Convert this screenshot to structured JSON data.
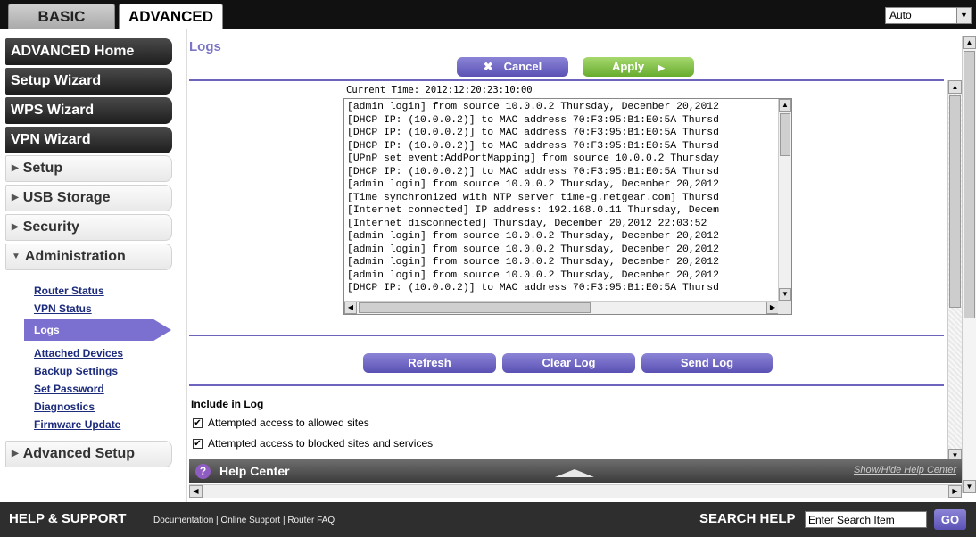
{
  "tabs": {
    "basic": "BASIC",
    "advanced": "ADVANCED"
  },
  "language_select": {
    "value": "Auto"
  },
  "sidebar": {
    "dark_items": [
      "ADVANCED Home",
      "Setup Wizard",
      "WPS Wizard",
      "VPN Wizard"
    ],
    "sections": [
      "Setup",
      "USB Storage",
      "Security",
      "Administration"
    ],
    "admin_links": [
      "Router Status",
      "VPN Status",
      "Logs",
      "Attached Devices",
      "Backup Settings",
      "Set Password",
      "Diagnostics",
      "Firmware Update"
    ],
    "advanced_setup": "Advanced Setup"
  },
  "main": {
    "title": "Logs",
    "cancel": "Cancel",
    "apply": "Apply",
    "current_time": "Current Time: 2012:12:20:23:10:00",
    "log_lines": [
      "[admin login] from source 10.0.0.2 Thursday, December 20,2012",
      "[DHCP IP: (10.0.0.2)] to MAC address 70:F3:95:B1:E0:5A Thursd",
      "[DHCP IP: (10.0.0.2)] to MAC address 70:F3:95:B1:E0:5A Thursd",
      "[DHCP IP: (10.0.0.2)] to MAC address 70:F3:95:B1:E0:5A Thursd",
      "[UPnP set event:AddPortMapping] from source 10.0.0.2 Thursday",
      "[DHCP IP: (10.0.0.2)] to MAC address 70:F3:95:B1:E0:5A Thursd",
      "[admin login] from source 10.0.0.2 Thursday, December 20,2012",
      "[Time synchronized with NTP server time-g.netgear.com] Thursd",
      "[Internet connected] IP address: 192.168.0.11 Thursday, Decem",
      "[Internet disconnected] Thursday, December 20,2012 22:03:52",
      "[admin login] from source 10.0.0.2 Thursday, December 20,2012",
      "[admin login] from source 10.0.0.2 Thursday, December 20,2012",
      "[admin login] from source 10.0.0.2 Thursday, December 20,2012",
      "[admin login] from source 10.0.0.2 Thursday, December 20,2012",
      "[DHCP IP: (10.0.0.2)] to MAC address 70:F3:95:B1:E0:5A Thursd"
    ],
    "refresh": "Refresh",
    "clear_log": "Clear Log",
    "send_log": "Send Log",
    "include_title": "Include in Log",
    "include_options": [
      {
        "label": "Attempted access to allowed sites",
        "checked": true
      },
      {
        "label": "Attempted access to blocked sites and services",
        "checked": true
      }
    ]
  },
  "help": {
    "title": "Help Center",
    "toggle": "Show/Hide Help Center"
  },
  "footer": {
    "title": "HELP & SUPPORT",
    "links": [
      "Documentation",
      "Online Support",
      "Router FAQ"
    ],
    "search_label": "SEARCH HELP",
    "search_value": "Enter Search Item",
    "go": "GO"
  },
  "colors": {
    "accent_purple": "#5a51b4",
    "apply_green": "#67ac2e",
    "title_purple": "#7b75c5"
  }
}
